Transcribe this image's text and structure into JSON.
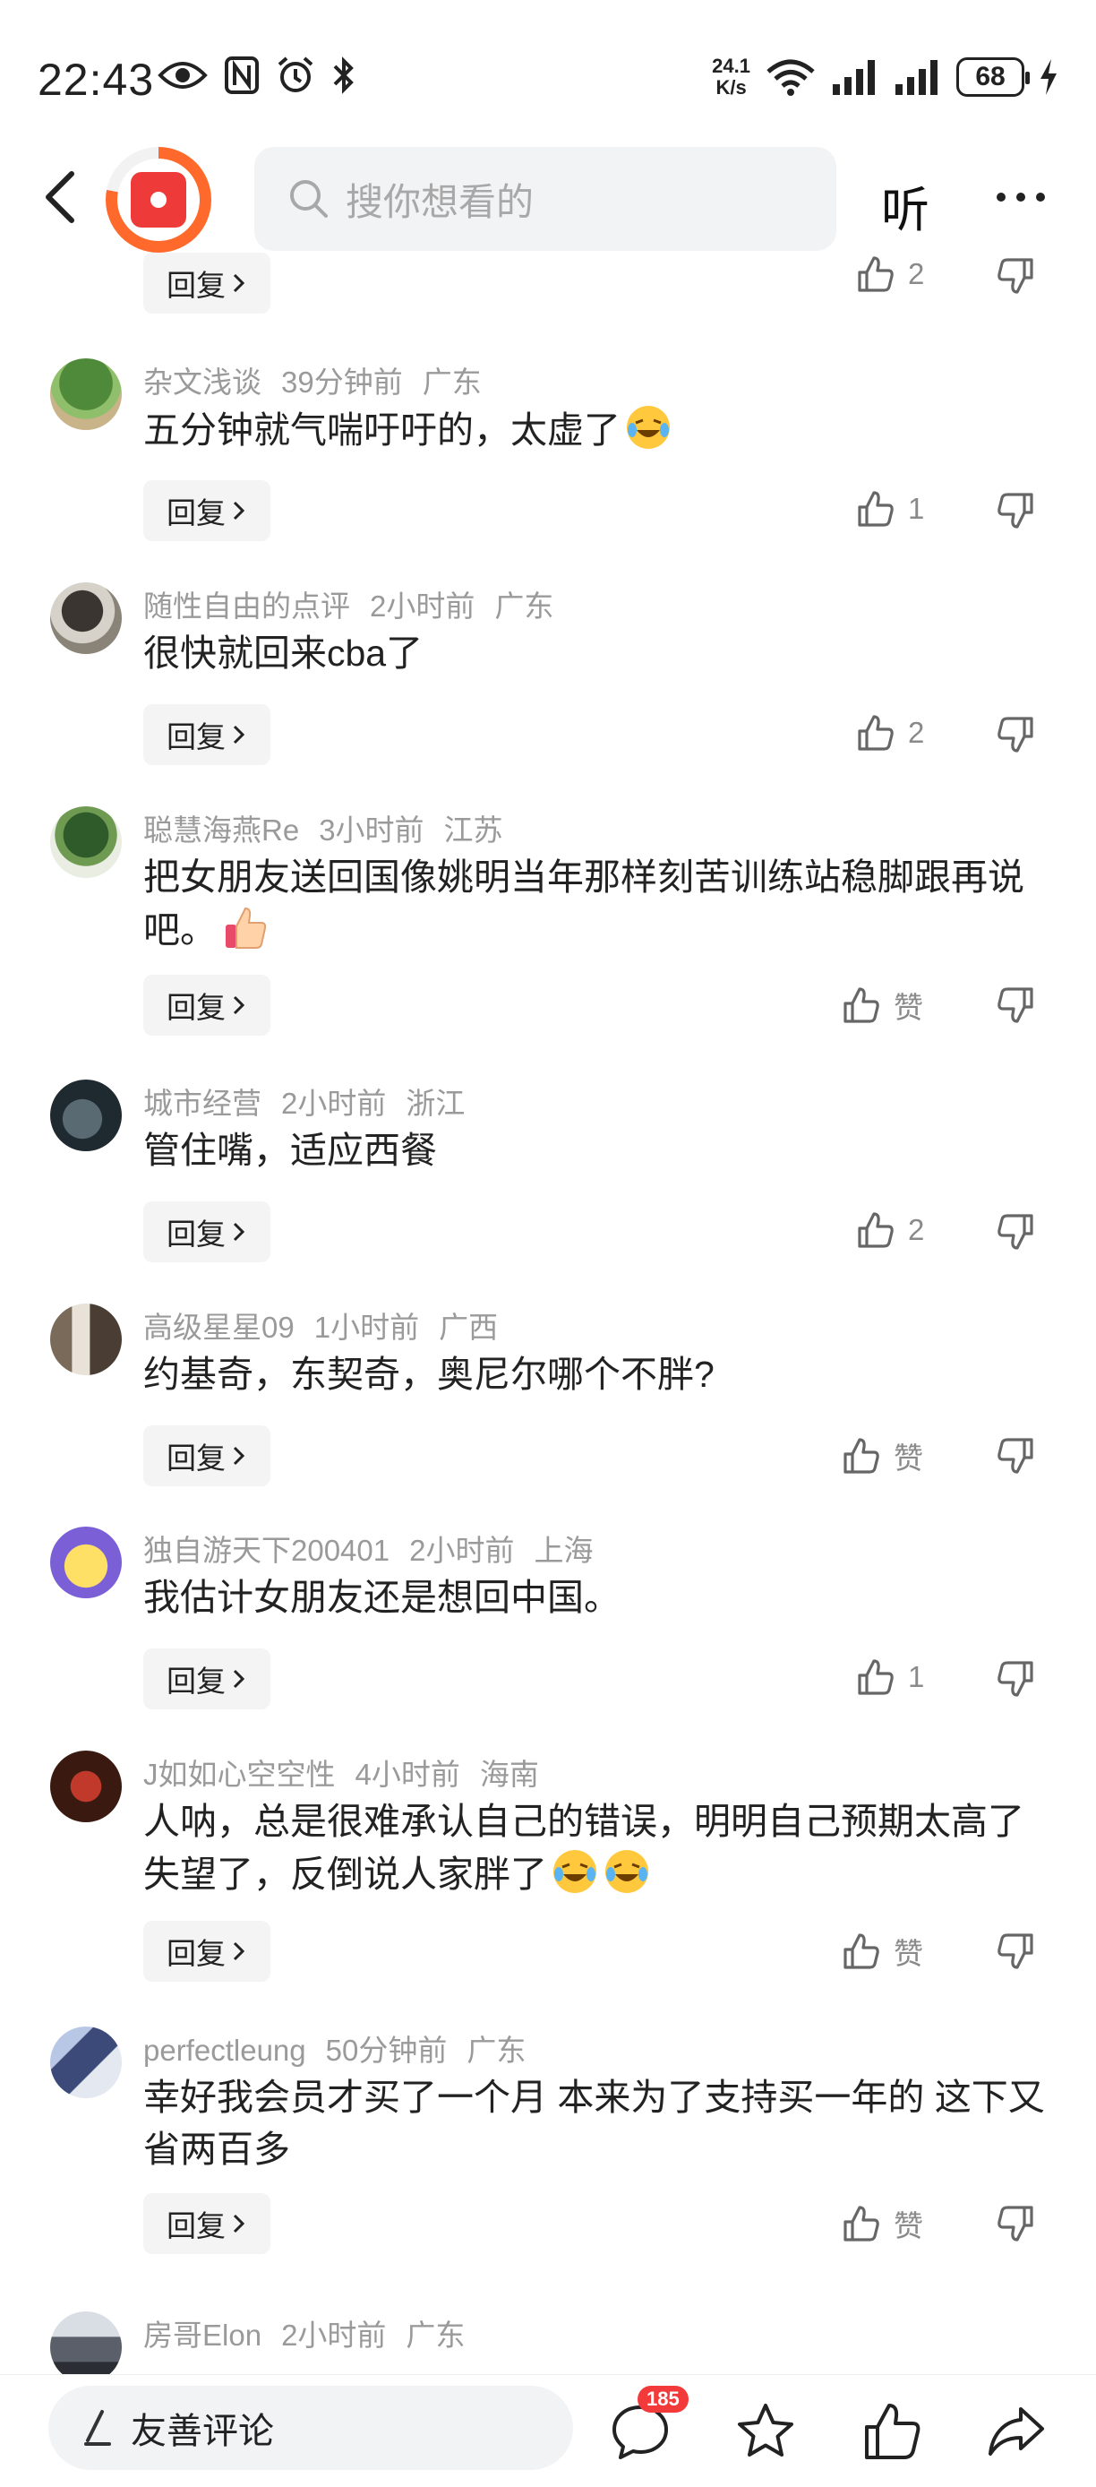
{
  "status_bar": {
    "time": "22:43",
    "net_speed_value": "24.1",
    "net_speed_unit": "K/s",
    "battery": "68"
  },
  "nav": {
    "search_placeholder": "搜你想看的",
    "listen_label": "听"
  },
  "comments": [
    {
      "user": "",
      "time": "",
      "location": "",
      "text": "",
      "reply_label": "回复",
      "like_label": "2",
      "like_count": 2
    },
    {
      "user": "杂文浅谈",
      "time": "39分钟前",
      "location": "广东",
      "text": "五分钟就气喘吁吁的，太虚了",
      "emojis": 1,
      "reply_label": "回复",
      "like_label": "1",
      "like_count": 1
    },
    {
      "user": "随性自由的点评",
      "time": "2小时前",
      "location": "广东",
      "text": "很快就回来cba了",
      "reply_label": "回复",
      "like_label": "2",
      "like_count": 2
    },
    {
      "user": "聪慧海燕Re",
      "time": "3小时前",
      "location": "江苏",
      "text": "把女朋友送回国像姚明当年那样刻苦训练站稳脚跟再说吧。",
      "emojis": 1,
      "reply_label": "回复",
      "like_label": "赞",
      "like_count": 0
    },
    {
      "user": "城市经营",
      "time": "2小时前",
      "location": "浙江",
      "text": "管住嘴，适应西餐",
      "reply_label": "回复",
      "like_label": "2",
      "like_count": 2
    },
    {
      "user": "高级星星09",
      "time": "1小时前",
      "location": "广西",
      "text": "约基奇，东契奇，奥尼尔哪个不胖?",
      "reply_label": "回复",
      "like_label": "赞",
      "like_count": 0
    },
    {
      "user": "独自游天下200401",
      "time": "2小时前",
      "location": "上海",
      "text": "我估计女朋友还是想回中国。",
      "reply_label": "回复",
      "like_label": "1",
      "like_count": 1
    },
    {
      "user": "J如如心空空性",
      "time": "4小时前",
      "location": "海南",
      "text": "人呐，总是很难承认自己的错误，明明自己预期太高了失望了，反倒说人家胖了",
      "emojis": 2,
      "reply_label": "回复",
      "like_label": "赞",
      "like_count": 0
    },
    {
      "user": "perfectleung",
      "time": "50分钟前",
      "location": "广东",
      "text": "幸好我会员才买了一个月 本来为了支持买一年的 这下又省两百多",
      "reply_label": "回复",
      "like_label": "赞",
      "like_count": 0
    },
    {
      "user": "房哥Elon",
      "time": "2小时前",
      "location": "广东",
      "text": ""
    }
  ],
  "bottom_bar": {
    "comment_placeholder": "友善评论",
    "comment_count_badge": "185"
  },
  "colors": {
    "accent_red": "#f23a3a",
    "logo_orange": "#ff6a2c",
    "meta_gray": "#9a9a9a"
  }
}
